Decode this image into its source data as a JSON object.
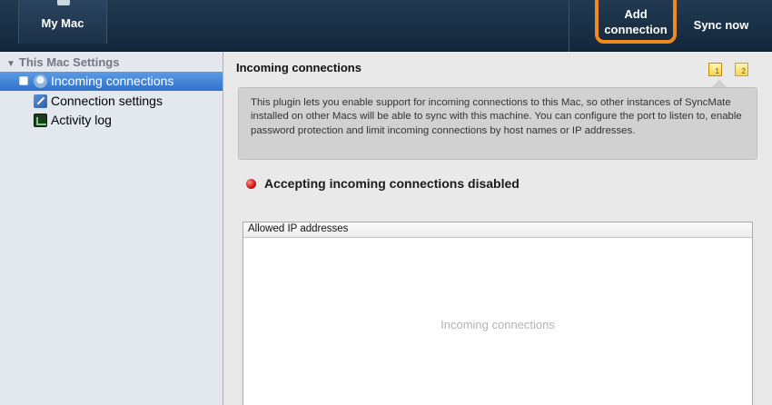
{
  "toolbar": {
    "my_mac_label": "My Mac",
    "add_connection_label": "Add\nconnection",
    "sync_now_label": "Sync now",
    "accent_color": "#f08a1c"
  },
  "sidebar": {
    "section_title": "This Mac Settings",
    "items": [
      {
        "label": "Incoming connections",
        "icon": "globe-icon",
        "selected": true
      },
      {
        "label": "Connection settings",
        "icon": "settings-icon",
        "selected": false
      },
      {
        "label": "Activity log",
        "icon": "activity-log-icon",
        "selected": false
      }
    ]
  },
  "main": {
    "title": "Incoming connections",
    "badges": [
      "1",
      "2"
    ],
    "info_text": "This plugin lets you enable support for incoming connections to this Mac, so other instances of SyncMate installed on other Macs will be able to sync with this machine. You can configure the port to listen to, enable password protection and limit incoming connections by host names or IP addresses.",
    "status_text": "Accepting incoming connections disabled",
    "status_color": "#d01010",
    "table_header": "Allowed IP addresses",
    "table_placeholder": "Incoming connections"
  }
}
